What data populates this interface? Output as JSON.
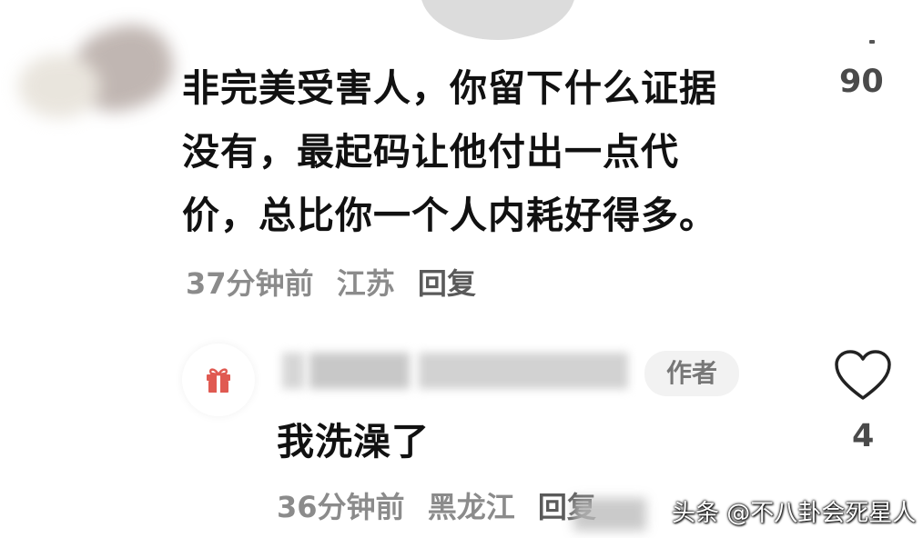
{
  "comment": {
    "lines": [
      "非完美受害人，你留下什么证据",
      "没有，最起码让他付出一点代",
      "价，总比你一个人内耗好得多。"
    ],
    "likes": "90",
    "time": "37分钟前",
    "location": "江苏",
    "reply_label": "回复"
  },
  "reply": {
    "avatar_icon": "gift-icon",
    "author_badge": "作者",
    "text": "我洗澡了",
    "likes": "4",
    "like_icon": "heart-icon",
    "time": "36分钟前",
    "location": "黑龙江",
    "reply_label": "回复"
  },
  "watermark": "头条 @不八卦会死星人",
  "colors": {
    "text_primary": "#111111",
    "text_meta": "#8b8b8b",
    "badge_bg": "#f2f2f2",
    "gift_red": "#e05a52"
  }
}
